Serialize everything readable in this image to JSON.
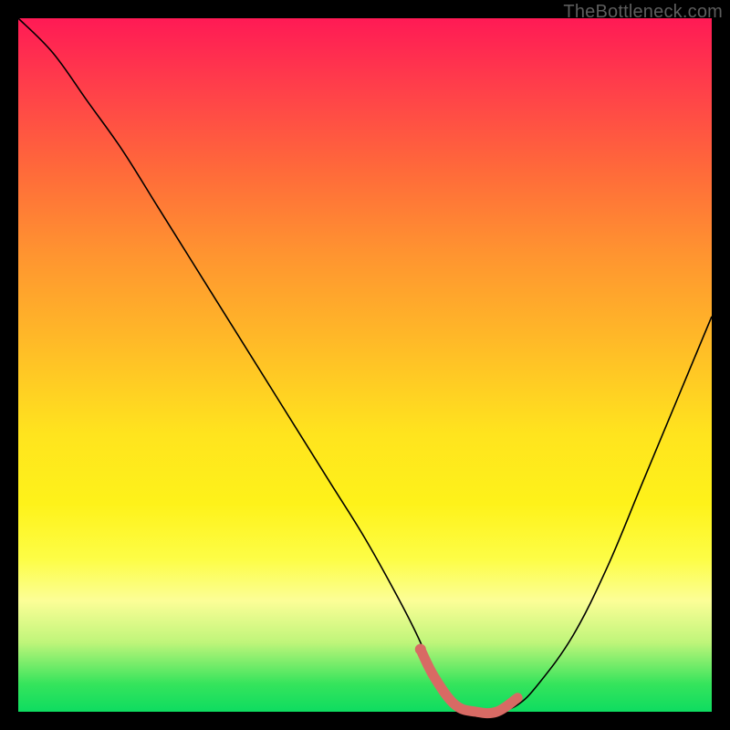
{
  "watermark": "TheBottleneck.com",
  "chart_data": {
    "type": "line",
    "title": "",
    "xlabel": "",
    "ylabel": "",
    "xlim": [
      0,
      100
    ],
    "ylim": [
      0,
      100
    ],
    "grid": false,
    "legend": false,
    "background": "rainbow-gradient-red-to-green",
    "series": [
      {
        "name": "bottleneck-curve",
        "color": "#000000",
        "x": [
          0,
          5,
          10,
          15,
          20,
          25,
          30,
          35,
          40,
          45,
          50,
          55,
          58,
          60,
          63,
          66,
          69,
          72,
          75,
          80,
          85,
          90,
          95,
          100
        ],
        "y": [
          100,
          95,
          88,
          81,
          73,
          65,
          57,
          49,
          41,
          33,
          25,
          16,
          10,
          5,
          1,
          0,
          0,
          1,
          4,
          11,
          21,
          33,
          45,
          57
        ]
      }
    ],
    "annotations": [
      {
        "name": "optimal-range-highlight",
        "type": "segment",
        "color": "#d86a64",
        "x": [
          58,
          60,
          63,
          66,
          69,
          72
        ],
        "y": [
          9,
          5,
          1,
          0,
          0,
          2
        ]
      }
    ]
  }
}
